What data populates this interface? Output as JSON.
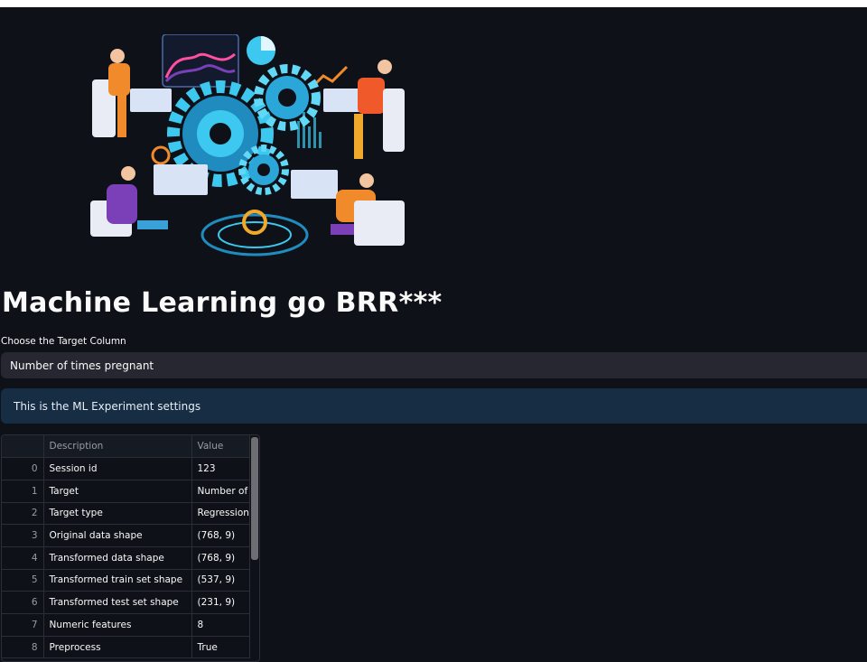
{
  "page": {
    "title": "Machine Learning go BRR***",
    "select_label": "Choose the Target Column",
    "selected_value": "Number of times pregnant",
    "info_message": "This is the ML Experiment settings"
  },
  "table": {
    "columns": [
      "",
      "Description",
      "Value"
    ],
    "rows": [
      [
        "0",
        "Session id",
        "123"
      ],
      [
        "1",
        "Target",
        "Number of"
      ],
      [
        "2",
        "Target type",
        "Regression"
      ],
      [
        "3",
        "Original data shape",
        "(768, 9)"
      ],
      [
        "4",
        "Transformed data shape",
        "(768, 9)"
      ],
      [
        "5",
        "Transformed train set shape",
        "(537, 9)"
      ],
      [
        "6",
        "Transformed test set shape",
        "(231, 9)"
      ],
      [
        "7",
        "Numeric features",
        "8"
      ],
      [
        "8",
        "Preprocess",
        "True"
      ]
    ]
  },
  "colors": {
    "background": "#0e1117",
    "select_bg": "#262730",
    "info_bg": "#172d43",
    "gear": "#3cc8ef",
    "accent_orange": "#f08a2a",
    "accent_purple": "#7b3fb8"
  },
  "illustration": {
    "subject": "isometric-machine-learning-team-illustration"
  }
}
